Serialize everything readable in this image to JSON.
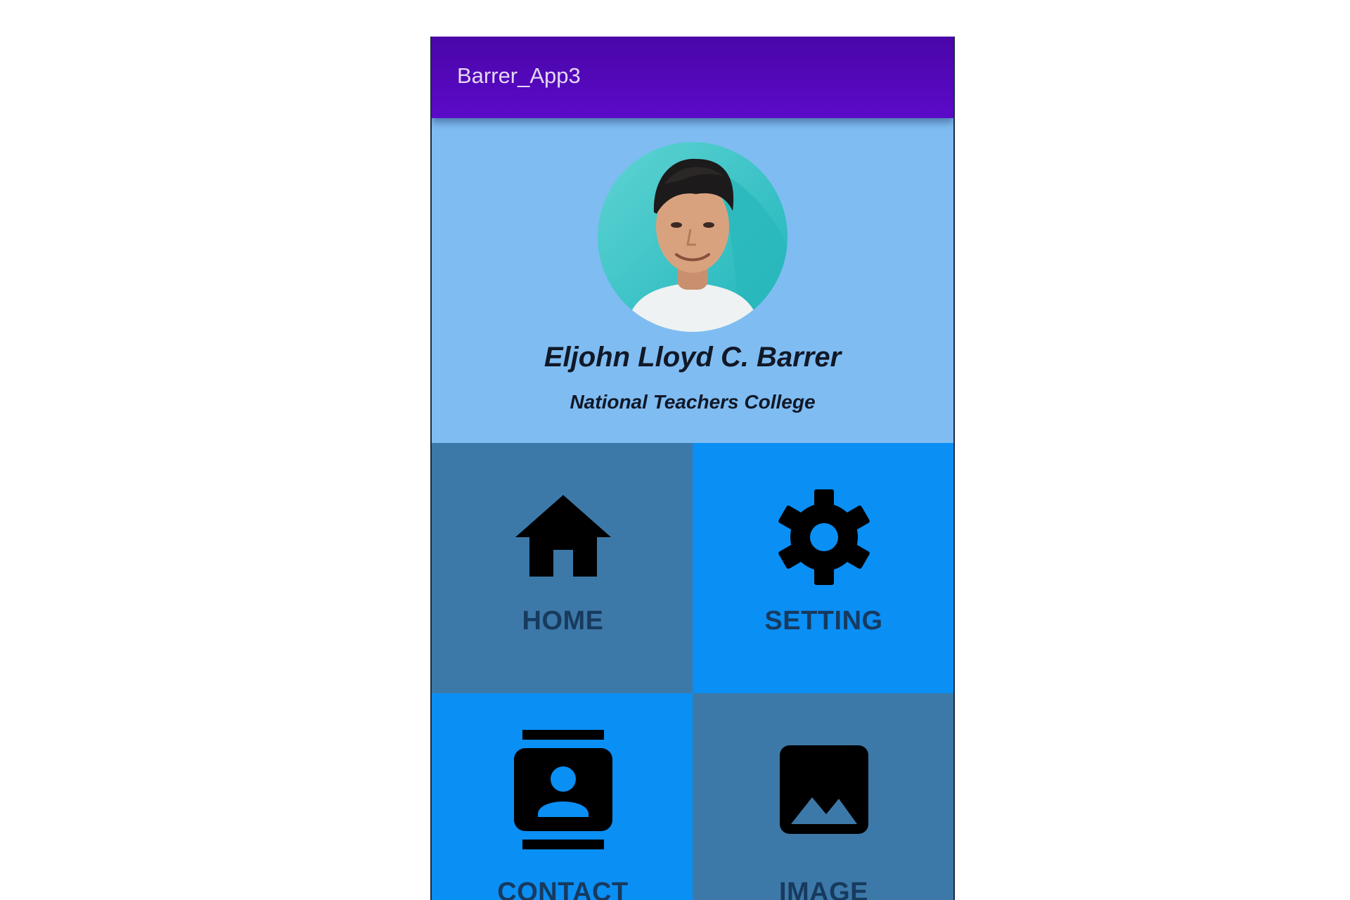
{
  "app": {
    "title": "Barrer_App3",
    "colors": {
      "appbar": "#4a06a8",
      "profile_bg": "#7fbcf2",
      "tile_dark": "#3d79a8",
      "tile_bright": "#0a8ff5",
      "label": "#173a5e"
    }
  },
  "profile": {
    "name": "Eljohn Lloyd C. Barrer",
    "school": "National Teachers College",
    "avatar_icon": "profile-photo"
  },
  "tiles": [
    {
      "label": "HOME",
      "icon": "home-icon"
    },
    {
      "label": "SETTING",
      "icon": "gear-icon"
    },
    {
      "label": "CONTACT",
      "icon": "contact-book-icon"
    },
    {
      "label": "IMAGE",
      "icon": "image-icon"
    }
  ]
}
